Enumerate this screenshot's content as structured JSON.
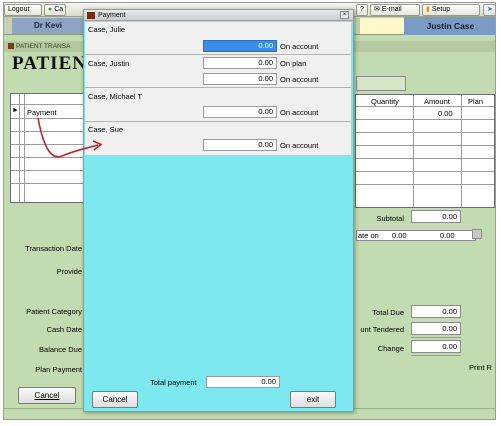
{
  "toolbar": {
    "buttons": [
      "Logout",
      "Ca",
      "E-mail",
      "Setup"
    ]
  },
  "header": {
    "doctor_tab": "Dr Kevi",
    "patient_tab": "Justin Case"
  },
  "patient_window": {
    "titlebar": "PATIENT TRANSA",
    "heading": "PATIEN",
    "table_headers": [
      "Quantity",
      "Amount",
      "Plan"
    ],
    "first_row_label": "Payment",
    "first_row_amount": "0.00",
    "subtotal_label": "Subtotal",
    "subtotal_value": "0.00",
    "rate_on_label": "ate on",
    "rate_on_value": "0.00",
    "rate_amount": "0.00",
    "left_labels": [
      "Transaction Date",
      "Provide",
      "Patient Category",
      "Cash Date",
      "Balance Due",
      "Plan Payment"
    ],
    "total_due_label": "Total Due",
    "total_due_value": "0.00",
    "amount_tendered_label": "unt Tendered",
    "amount_tendered_value": "0.00",
    "change_label": "Change",
    "change_value": "0.00",
    "print_label": "Print R",
    "cancel_label": "Cancel"
  },
  "dialog": {
    "title": "Payment",
    "patients": [
      {
        "name": "Case, Julie",
        "lines": [
          {
            "amount": "0.00",
            "type": "On account",
            "selected": true
          }
        ]
      },
      {
        "name": "Case, Justin",
        "lines": [
          {
            "amount": "0.00",
            "type": "On plan",
            "selected": false
          },
          {
            "amount": "0.00",
            "type": "On account",
            "selected": false
          }
        ]
      },
      {
        "name": "Case, Michael T",
        "lines": [
          {
            "amount": "0.00",
            "type": "On account",
            "selected": false
          }
        ]
      },
      {
        "name": "Case, Sue",
        "lines": [
          {
            "amount": "0.00",
            "type": "On account",
            "selected": false
          }
        ]
      }
    ],
    "total_label": "Total payment",
    "total_value": "0.00",
    "cancel_label": "Cancel",
    "exit_label": "exit"
  },
  "colors": {
    "dialog_bg": "#7de8ef",
    "selected": "#3a8ee8",
    "window_bg": "#c2dbb0",
    "arrow": "#b5282a"
  }
}
